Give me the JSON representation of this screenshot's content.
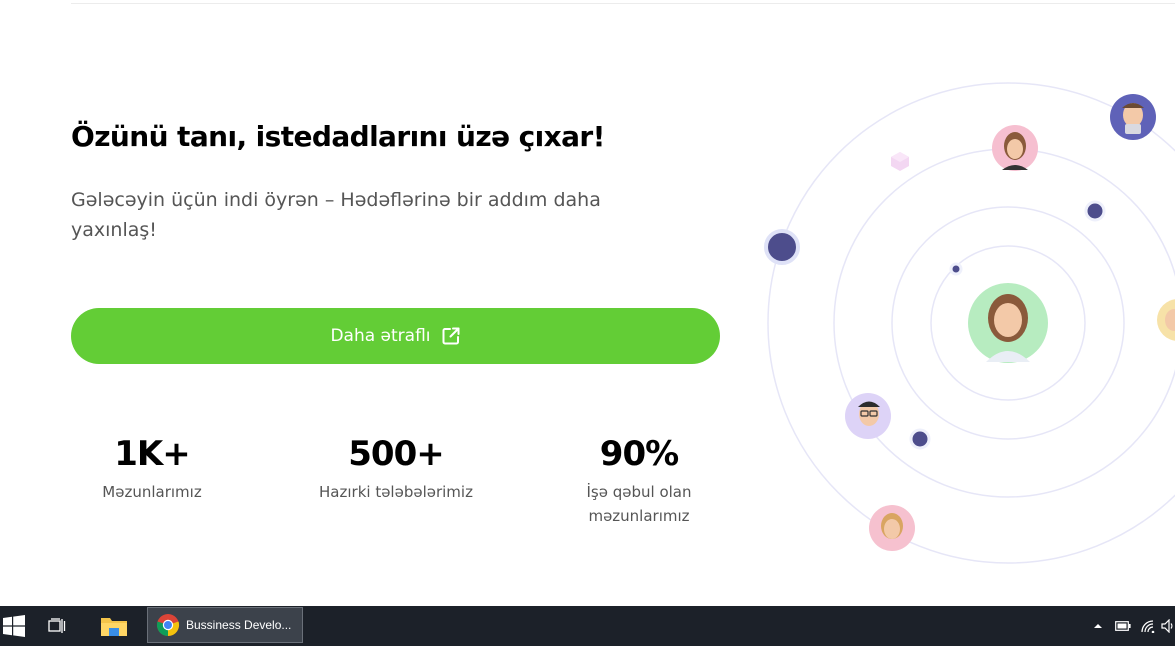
{
  "hero": {
    "title": "Özünü tanı, istedadlarını üzə çıxar!",
    "subtitle": "Gələcəyin üçün indi öyrən – Hədəflərinə bir addım daha yaxınlaş!",
    "cta_label": "Daha ətraflı"
  },
  "stats": [
    {
      "value": "1K+",
      "label": "Məzunlarımız"
    },
    {
      "value": "500+",
      "label": "Hazırki tələbələrimiz"
    },
    {
      "value": "90%",
      "label": "İşə qəbul olan məzunlarımız"
    }
  ],
  "colors": {
    "accent_green": "#63cd36",
    "dot_navy": "#4d4d8c",
    "orbit_line": "#e6e6f7",
    "taskbar": "#1c2129"
  },
  "taskbar": {
    "start_icon": "windows-logo-icon",
    "task_view_icon": "task-view-icon",
    "explorer_icon": "folder-icon",
    "chrome_task_label": "Bussiness Develo...",
    "tray_icons": [
      "chevron-up-icon",
      "battery-icon",
      "wifi-icon",
      "volume-icon"
    ]
  }
}
